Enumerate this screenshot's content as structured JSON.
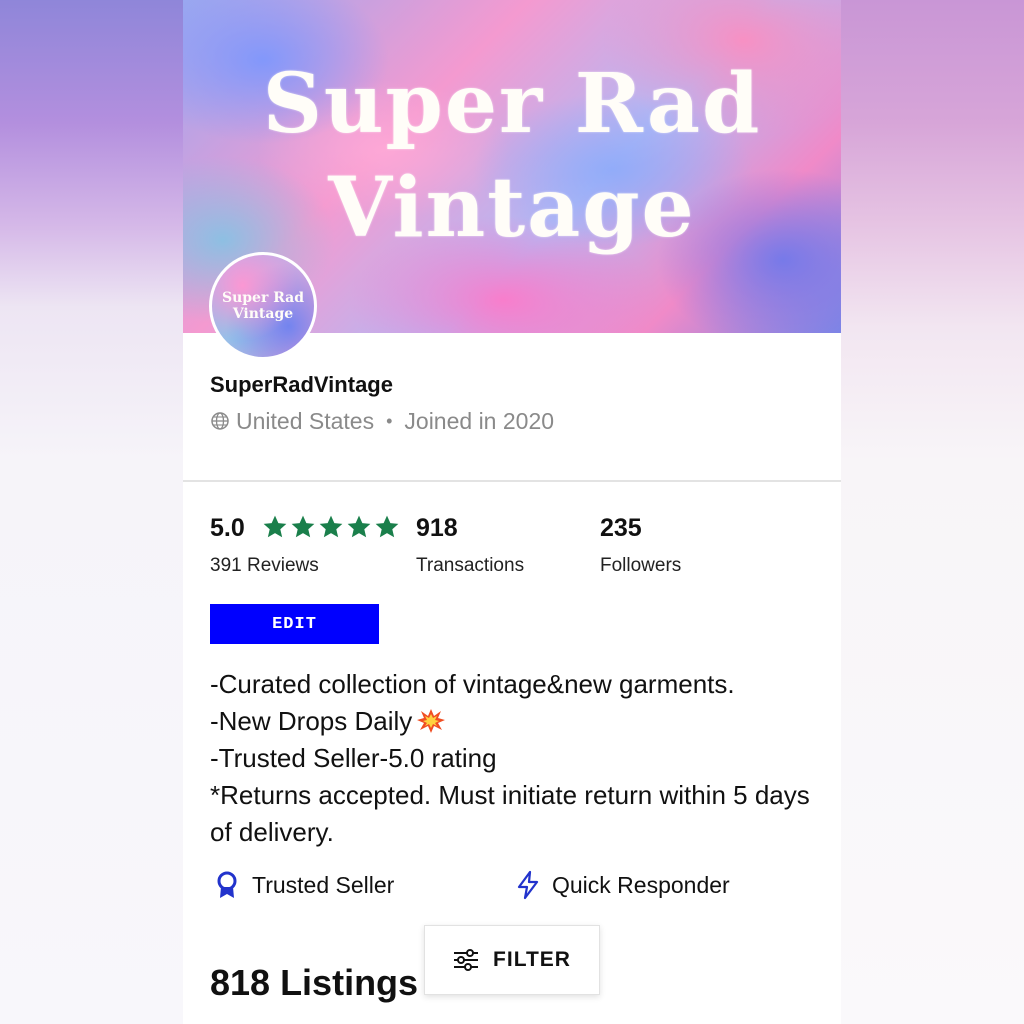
{
  "banner": {
    "title": "Super Rad Vintage"
  },
  "avatar": {
    "text": "Super Rad\nVintage"
  },
  "shop": {
    "name": "SuperRadVintage",
    "location": "United States",
    "separator": "•",
    "joined": "Joined in 2020"
  },
  "stats": {
    "rating": "5.0",
    "stars": 5,
    "reviews_label": "391 Reviews",
    "transactions": "918",
    "transactions_label": "Transactions",
    "followers": "235",
    "followers_label": "Followers"
  },
  "edit_label": "EDIT",
  "bio": {
    "line1": "-Curated collection of vintage&new garments.",
    "line2": "-New Drops Daily",
    "line3": "-Trusted Seller-5.0 rating",
    "line4": "*Returns accepted. Must initiate return within 5 days of delivery."
  },
  "badges": {
    "trusted": "Trusted Seller",
    "quick": "Quick Responder"
  },
  "listings": {
    "title": "818 Listings"
  },
  "filter": {
    "label": "FILTER"
  },
  "colors": {
    "star_green": "#1a7f4b",
    "edit_blue": "#0000ff",
    "badge_blue": "#2233cc"
  }
}
